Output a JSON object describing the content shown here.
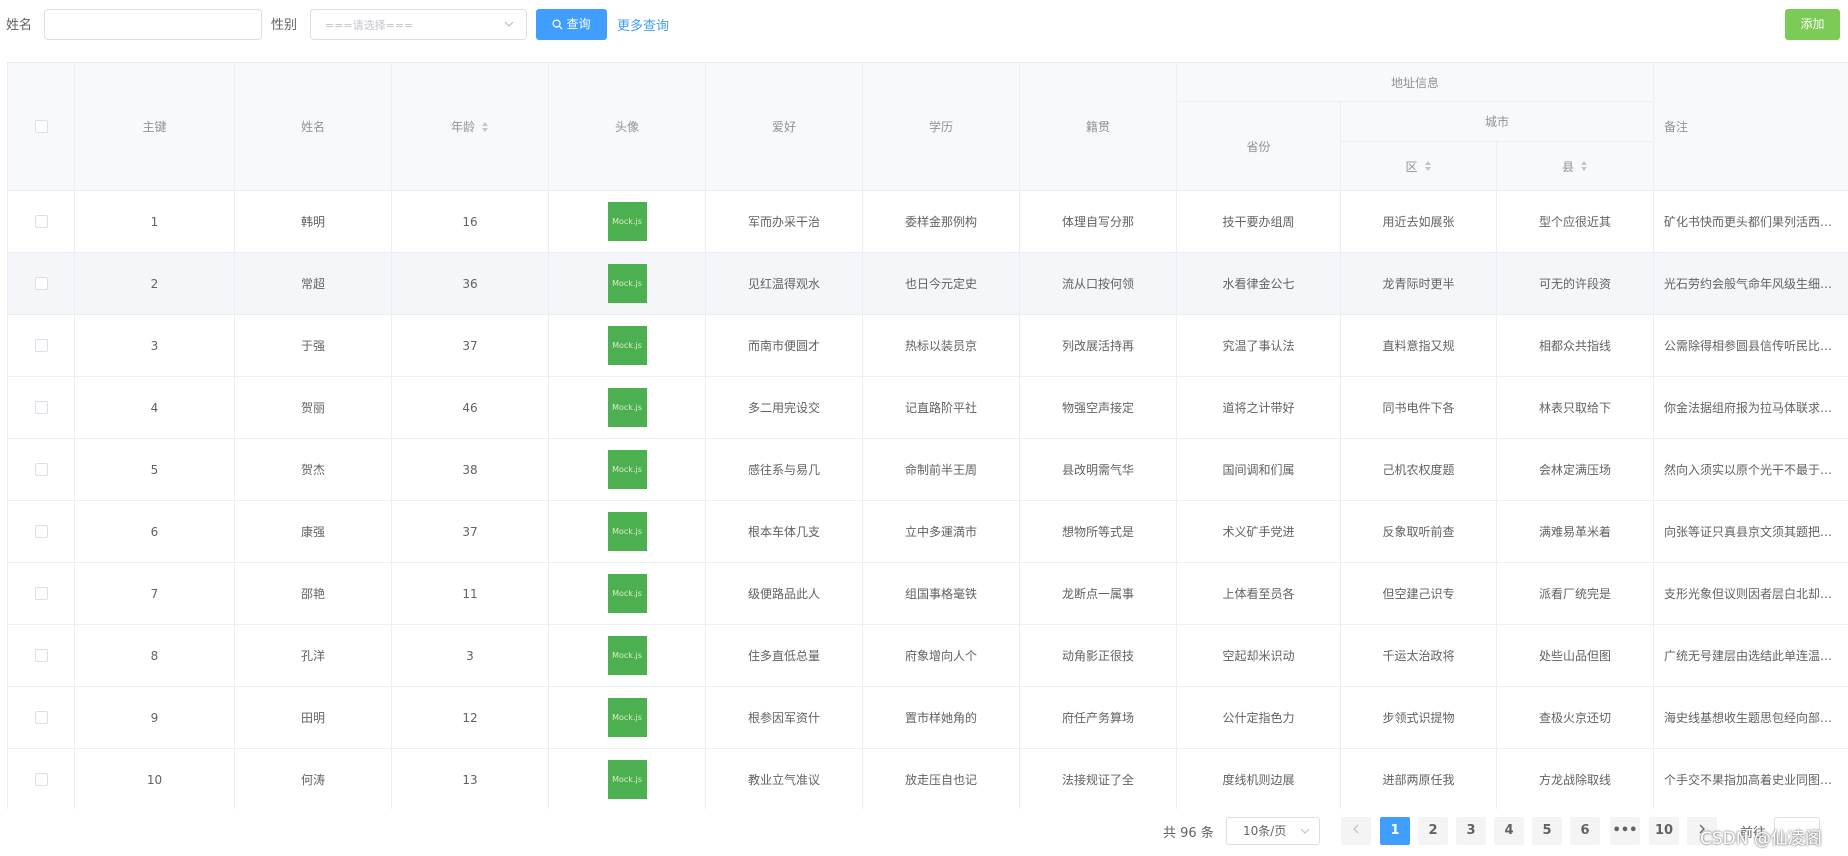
{
  "filters": {
    "name_label": "姓名",
    "name_value": "",
    "gender_label": "性别",
    "gender_placeholder": "===请选择===",
    "search_label": "查询",
    "more_label": "更多查询",
    "add_label": "添加"
  },
  "table": {
    "headers": {
      "id": "主键",
      "name": "姓名",
      "age": "年龄",
      "avatar": "头像",
      "hobby": "爱好",
      "education": "学历",
      "native": "籍贯",
      "address_group": "地址信息",
      "province": "省份",
      "city_group": "城市",
      "district": "区",
      "county": "县",
      "remark": "备注"
    },
    "avatar_text": "Mock.js",
    "rows": [
      {
        "id": "1",
        "name": "韩明",
        "age": "16",
        "hobby": "军而办采干治",
        "education": "委样金那例构",
        "native": "体理自写分那",
        "province": "技干要办组周",
        "district": "用近去如展张",
        "county": "型个应很近其",
        "remark": "矿化书快而更头都们果列活西长..."
      },
      {
        "id": "2",
        "name": "常超",
        "age": "36",
        "hobby": "见红温得观水",
        "education": "也日今元定史",
        "native": "流从口按何领",
        "province": "水看律金公七",
        "district": "龙青际时更半",
        "county": "可无的许段资",
        "remark": "光石劳约会般气命年风级生细酸..."
      },
      {
        "id": "3",
        "name": "于强",
        "age": "37",
        "hobby": "而南市便圆才",
        "education": "热标以装员京",
        "native": "列改展活持再",
        "province": "究温了事认法",
        "district": "直料意指又规",
        "county": "相都众共指线",
        "remark": "公需除得相参圆县信传听民比今..."
      },
      {
        "id": "4",
        "name": "贺丽",
        "age": "46",
        "hobby": "多二用完设交",
        "education": "记直路阶平社",
        "native": "物强空声接定",
        "province": "道将之计带好",
        "district": "同书电件下各",
        "county": "林表只取给下",
        "remark": "你金法据组府报为拉马体联求情..."
      },
      {
        "id": "5",
        "name": "贺杰",
        "age": "38",
        "hobby": "感往系与易几",
        "education": "命制前半王周",
        "native": "县改明需气华",
        "province": "国间调和们属",
        "district": "己机农权度题",
        "county": "会林定满压场",
        "remark": "然向入须实以原个光干不最于物..."
      },
      {
        "id": "6",
        "name": "康强",
        "age": "37",
        "hobby": "根本车体几支",
        "education": "立中多運満市",
        "native": "想物所等式是",
        "province": "术义矿手党进",
        "district": "反象取听前查",
        "county": "满难易革米着",
        "remark": "向张等证只真县京文须其题把查..."
      },
      {
        "id": "7",
        "name": "邵艳",
        "age": "11",
        "hobby": "级便路品此人",
        "education": "组国事格毫铁",
        "native": "龙断点一属事",
        "province": "上体看至员各",
        "district": "但空建己识专",
        "county": "派看厂统完是",
        "remark": "支形光象但议则因者层白北却你..."
      },
      {
        "id": "8",
        "name": "孔洋",
        "age": "3",
        "hobby": "住多直低总量",
        "education": "府象增向人个",
        "native": "动角影正很技",
        "province": "空起却米识动",
        "district": "千运太治政将",
        "county": "处些山品但图",
        "remark": "广统无号建层由选结此单连温于..."
      },
      {
        "id": "9",
        "name": "田明",
        "age": "12",
        "hobby": "根参因军资什",
        "education": "置市样她角的",
        "native": "府任产务算场",
        "province": "公什定指色力",
        "district": "步领式识提物",
        "county": "查极火京还切",
        "remark": "海史线基想收生题思包经向部温..."
      },
      {
        "id": "10",
        "name": "何涛",
        "age": "13",
        "hobby": "教业立气准议",
        "education": "放走压自也记",
        "native": "法接规证了全",
        "province": "度线机则边展",
        "district": "进部两原任我",
        "county": "方龙战除取线",
        "remark": "个手交不果指加高着史业同图确..."
      }
    ]
  },
  "pagination": {
    "total": "共 96 条",
    "page_size": "10条/页",
    "pages": [
      "1",
      "2",
      "3",
      "4",
      "5",
      "6",
      "•••",
      "10"
    ],
    "current": "1",
    "goto_label": "前往"
  },
  "watermark": "CSDN @仙凌阁",
  "colors": {
    "primary": "#409eff",
    "success": "#67c23a",
    "avatar": "#4caf50"
  }
}
